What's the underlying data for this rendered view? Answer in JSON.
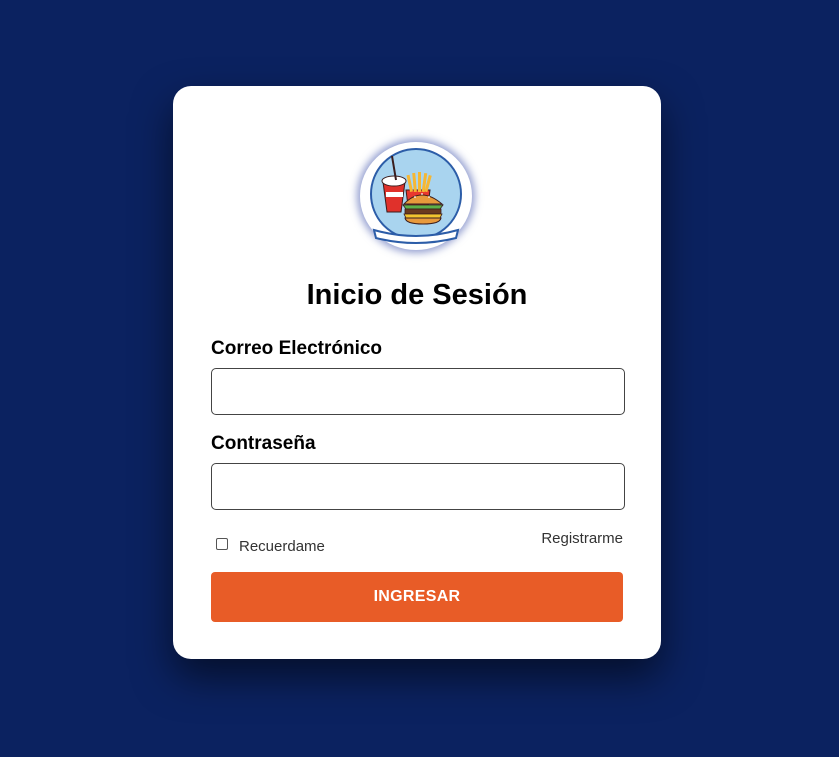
{
  "page": {
    "background_color": "#0b2260"
  },
  "login": {
    "logo_icon": "fast-food-logo-icon",
    "title": "Inicio de Sesión",
    "email": {
      "label": "Correo Electrónico",
      "value": "",
      "placeholder": ""
    },
    "password": {
      "label": "Contraseña",
      "value": "",
      "placeholder": ""
    },
    "remember": {
      "label": "Recuerdame",
      "checked": false
    },
    "register_link": "Registrarme",
    "submit_label": "INGRESAR",
    "accent_color": "#e85c27"
  }
}
